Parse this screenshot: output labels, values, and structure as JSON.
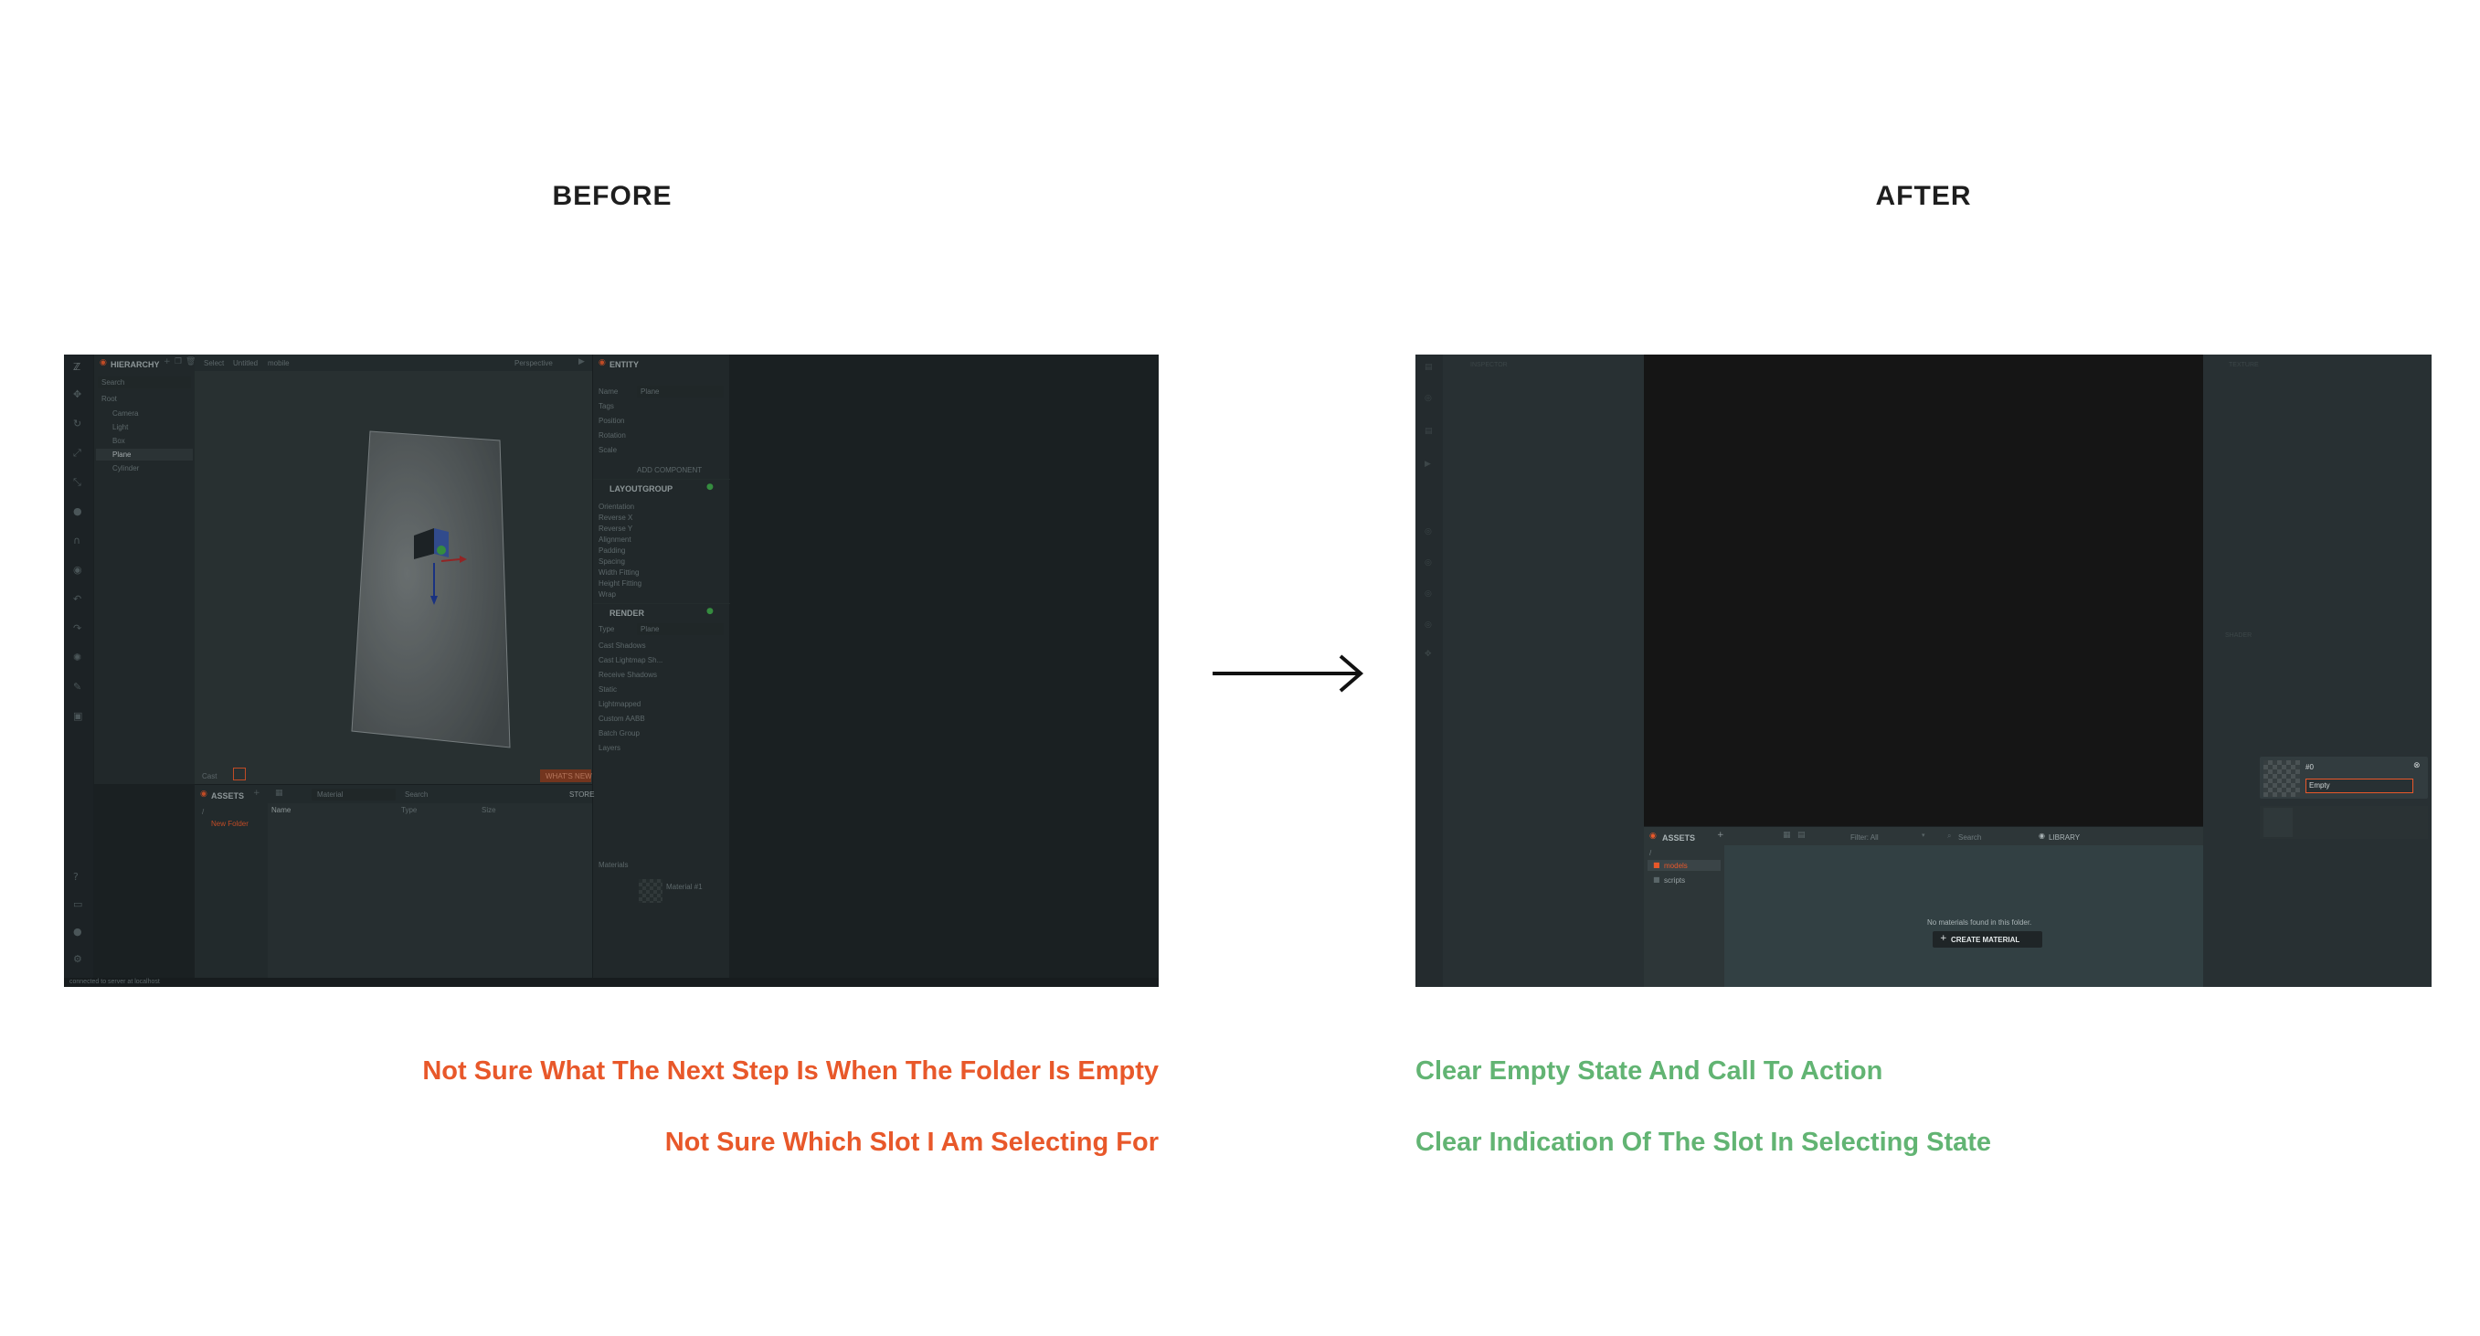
{
  "headings": {
    "before": "BEFORE",
    "after": "AFTER"
  },
  "captions": {
    "before": [
      "Not Sure What The Next Step Is When The Folder Is Empty",
      "Not Sure Which Slot I Am Selecting For"
    ],
    "after": [
      "Clear Empty State And Call To Action",
      "Clear Indication Of The Slot In Selecting State"
    ]
  },
  "colors": {
    "before_caption": "#e8582a",
    "after_caption": "#62b473",
    "accent": "#e8582a",
    "editor_bg": "#1e2426"
  },
  "before": {
    "hierarchy_title": "HIERARCHY",
    "hierarchy_search": "Search",
    "tree": [
      "Root",
      "Camera",
      "Light",
      "Box",
      "Plane",
      "Cylinder"
    ],
    "viewport_tabs": [
      "Select",
      "Untitled",
      "mobile"
    ],
    "camera_label": "Perspective",
    "viewport_footer_left": "Cast",
    "whats_new": "WHAT'S NEW",
    "assets_title": "ASSETS",
    "assets_filter": "Material",
    "assets_search": "Search",
    "store": "STORE",
    "folder_root": "/",
    "folder_new": "New Folder",
    "columns": [
      "Name",
      "Type",
      "Size"
    ],
    "entity_title": "ENTITY",
    "entity_rows": [
      "Name",
      "Tags",
      "Position",
      "Rotation",
      "Scale"
    ],
    "entity_name_value": "Plane",
    "add_component": "ADD COMPONENT",
    "layoutgroup_title": "LAYOUTGROUP",
    "layout_rows": [
      "Orientation",
      "Reverse X",
      "Reverse Y",
      "Alignment",
      "Padding",
      "Spacing",
      "Width Fitting",
      "Height Fitting",
      "Wrap"
    ],
    "render_title": "RENDER",
    "render_rows": [
      "Type",
      "Cast Shadows",
      "Cast Lightmap Sh...",
      "Receive Shadows",
      "Static",
      "Lightmapped",
      "Custom AABB",
      "Batch Group",
      "Layers"
    ],
    "render_type_value": "Plane",
    "material_label": "Materials",
    "material_slot": "Material #1",
    "status_bar": "connected to server at localhost"
  },
  "after": {
    "inspector_title": "INSPECTOR",
    "texture_title": "TEXTURE",
    "shader_title": "SHADER",
    "assets_title": "ASSETS",
    "filter": "Filter: All",
    "search": "Search",
    "library": "LIBRARY",
    "folder_root": "/",
    "folders": [
      "models",
      "scripts"
    ],
    "empty_message": "No materials found in this folder.",
    "create_material": "CREATE MATERIAL",
    "slot_number": "#0",
    "slot_value": "Empty"
  }
}
